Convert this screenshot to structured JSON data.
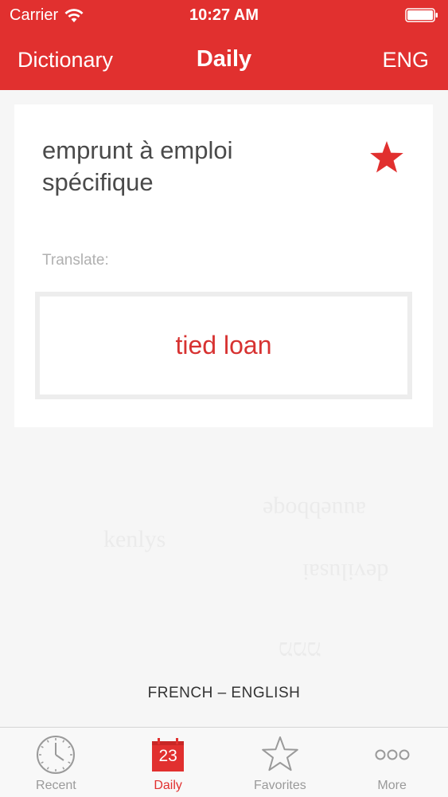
{
  "status_bar": {
    "carrier": "Carrier",
    "time": "10:27 AM"
  },
  "nav": {
    "left_label": "Dictionary",
    "title": "Daily",
    "right_label": "ENG"
  },
  "card": {
    "word": "emprunt à emploi spécifique",
    "favorite_icon": "star-icon",
    "translate_label": "Translate:",
    "translation": "tied loan"
  },
  "language_pair": "FRENCH – ENGLISH",
  "tabs": [
    {
      "label": "Recent",
      "icon": "clock-icon",
      "active": false
    },
    {
      "label": "Daily",
      "icon": "calendar-icon",
      "calendar_day": "23",
      "active": true
    },
    {
      "label": "Favorites",
      "icon": "star-outline-icon",
      "active": false
    },
    {
      "label": "More",
      "icon": "more-icon",
      "active": false
    }
  ],
  "colors": {
    "accent": "#e1302f",
    "background": "#f6f6f6",
    "tab_inactive": "#9a9a9a"
  }
}
